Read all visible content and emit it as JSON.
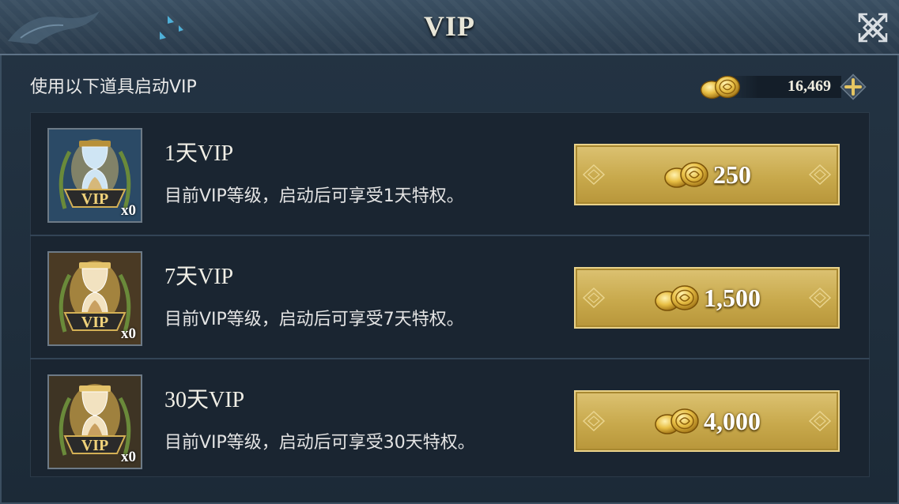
{
  "header": {
    "title": "VIP"
  },
  "subtitle": "使用以下道具启动VIP",
  "currency": {
    "amount": "16,469"
  },
  "items": [
    {
      "name": "1天VIP",
      "desc": "目前VIP等级，启动后可享受1天特权。",
      "qty": "x0",
      "price": "250",
      "icon": "hourglass-blue-vip-icon"
    },
    {
      "name": "7天VIP",
      "desc": "目前VIP等级，启动后可享受7天特权。",
      "qty": "x0",
      "price": "1,500",
      "icon": "hourglass-gold-vip-icon"
    },
    {
      "name": "30天VIP",
      "desc": "目前VIP等级，启动后可享受30天特权。",
      "qty": "x0",
      "price": "4,000",
      "icon": "hourglass-gold-vip-icon"
    }
  ],
  "icon_badge_text": "VIP",
  "colors": {
    "gold_button": "#c8a94c",
    "panel_bg": "#1d2a36",
    "header_bg": "#3a4f62"
  }
}
